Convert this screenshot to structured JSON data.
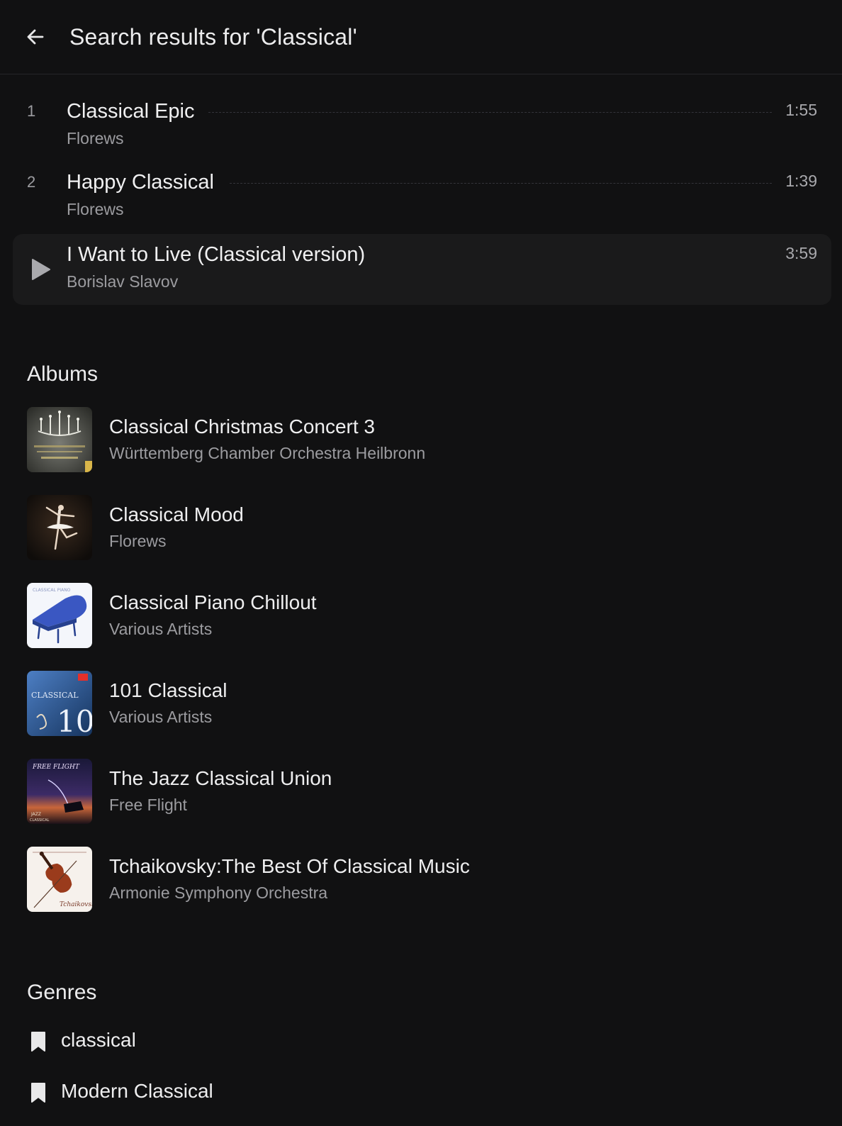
{
  "header": {
    "title": "Search results for 'Classical'",
    "back_icon": "arrow-left-icon"
  },
  "songs": [
    {
      "number": "1",
      "title": "Classical Epic",
      "artist": "Florews",
      "duration": "1:55"
    },
    {
      "number": "2",
      "title": "Happy Classical",
      "artist": "Florews",
      "duration": "1:39"
    },
    {
      "number": "",
      "title": "I Want to Live (Classical version)",
      "artist": "Borislav Slavov",
      "duration": "3:59",
      "state": "hovered",
      "icon": "play-icon"
    }
  ],
  "albums_section": {
    "title": "Albums",
    "items": [
      {
        "title": "Classical Christmas Concert 3",
        "artist": "Württemberg Chamber Orchestra Heilbronn",
        "cover": "chandelier-cover"
      },
      {
        "title": "Classical Mood",
        "artist": "Florews",
        "cover": "ballerina-cover"
      },
      {
        "title": "Classical Piano Chillout",
        "artist": "Various Artists",
        "cover": "grand-piano-cover"
      },
      {
        "title": "101 Classical",
        "artist": "Various Artists",
        "cover": "classical-101-cover"
      },
      {
        "title": "The Jazz Classical Union",
        "artist": "Free Flight",
        "cover": "night-sky-cover"
      },
      {
        "title": "Tchaikovsky:The Best Of Classical Music",
        "artist": "Armonie Symphony Orchestra",
        "cover": "violin-cover"
      }
    ]
  },
  "genres_section": {
    "title": "Genres",
    "items": [
      {
        "label": "classical",
        "icon": "bookmark-icon"
      },
      {
        "label": "Modern Classical",
        "icon": "bookmark-icon"
      }
    ]
  },
  "colors": {
    "background": "#111112",
    "hover_row": "#1a1a1b",
    "primary_text": "#eeeeef",
    "secondary_text": "#9c9ca0"
  }
}
